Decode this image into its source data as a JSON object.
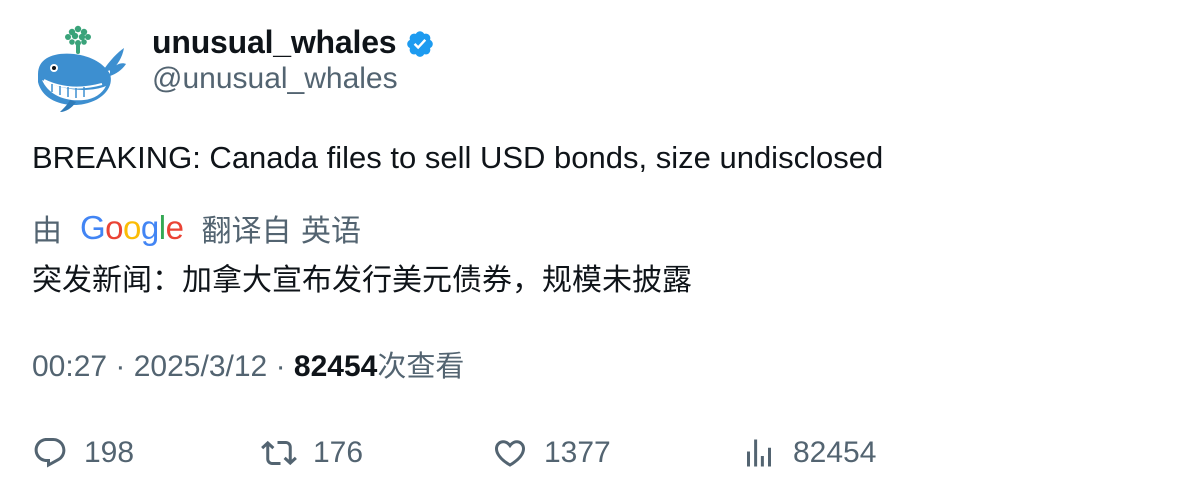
{
  "author": {
    "display_name": "unusual_whales",
    "handle": "@unusual_whales",
    "verified": true,
    "avatar_icon": "whale-avatar-icon",
    "verified_icon": "verified-badge-icon",
    "verified_color": "#1d9bf0"
  },
  "tweet": {
    "text": "BREAKING: Canada files to sell USD bonds, size undisclosed"
  },
  "translation": {
    "prefix": "由",
    "provider": "Google",
    "suffix": "翻译自 英语",
    "text": "突发新闻：加拿大宣布发行美元债券，规模未披露"
  },
  "meta": {
    "time": "00:27",
    "separator": "·",
    "date": "2025/3/12",
    "views_count": "82454",
    "views_label": "次查看"
  },
  "actions": {
    "replies": "198",
    "retweets": "176",
    "likes": "1377",
    "views": "82454",
    "icons": [
      "reply-icon",
      "retweet-icon",
      "like-icon",
      "views-icon"
    ]
  },
  "colors": {
    "text_primary": "#0f1419",
    "text_secondary": "#536471",
    "google_blue": "#4285F4",
    "google_red": "#EA4335",
    "google_yellow": "#FBBC05",
    "google_green": "#34A853"
  }
}
